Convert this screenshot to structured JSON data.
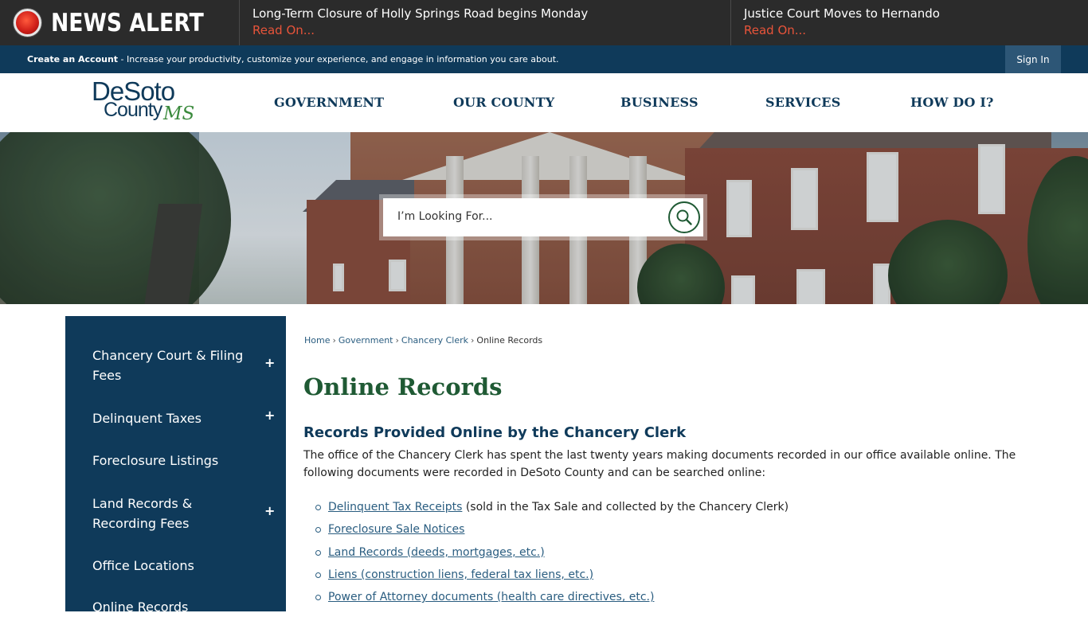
{
  "alert": {
    "label": "NEWS ALERT",
    "items": [
      {
        "title": "Long-Term Closure of Holly Springs Road begins Monday",
        "link": "Read On..."
      },
      {
        "title": "Justice Court Moves to Hernando",
        "link": "Read On..."
      }
    ]
  },
  "account": {
    "create_label": "Create an Account",
    "tagline": " - Increase your productivity, customize your experience, and engage in information you care about.",
    "signin": "Sign In"
  },
  "logo": {
    "line1": "DeSoto",
    "line2": "County",
    "line3": "MS"
  },
  "nav": [
    "GOVERNMENT",
    "OUR COUNTY",
    "BUSINESS",
    "SERVICES",
    "HOW DO I?"
  ],
  "search": {
    "placeholder": "I’m Looking For..."
  },
  "sidebar": {
    "items": [
      {
        "label": "Chancery Court & Filing Fees",
        "expand": "+"
      },
      {
        "label": "Delinquent Taxes",
        "expand": "+"
      },
      {
        "label": "Foreclosure Listings",
        "expand": ""
      },
      {
        "label": "Land Records & Recording Fees",
        "expand": "+"
      },
      {
        "label": "Office Locations",
        "expand": ""
      },
      {
        "label": "Online Records",
        "expand": ""
      }
    ]
  },
  "breadcrumb": {
    "items": [
      "Home",
      "Government",
      "Chancery Clerk"
    ],
    "current": "Online Records",
    "separator": "›"
  },
  "main": {
    "title": "Online Records",
    "section_heading": "Records Provided Online by the Chancery Clerk",
    "intro": "The office of the Chancery Clerk has spent the last twenty years making documents recorded in our office available online. The following documents were recorded in DeSoto County and can be searched online:",
    "documents": [
      {
        "link": "Delinquent Tax Receipts",
        "note": " (sold in the Tax Sale and collected by the Chancery Clerk)"
      },
      {
        "link": "Foreclosure Sale Notices",
        "note": ""
      },
      {
        "link": "Land Records (deeds, mortgages, etc.)",
        "note": ""
      },
      {
        "link": "Liens (construction liens, federal tax liens, etc.)",
        "note": ""
      },
      {
        "link": "Power of Attorney documents (health care directives, etc.)",
        "note": ""
      }
    ]
  },
  "colors": {
    "navy": "#0f3a5a",
    "green": "#1f5a34",
    "alert_bg": "#2b2b2b",
    "read_on": "#e8543a",
    "link": "#2a5d80"
  }
}
